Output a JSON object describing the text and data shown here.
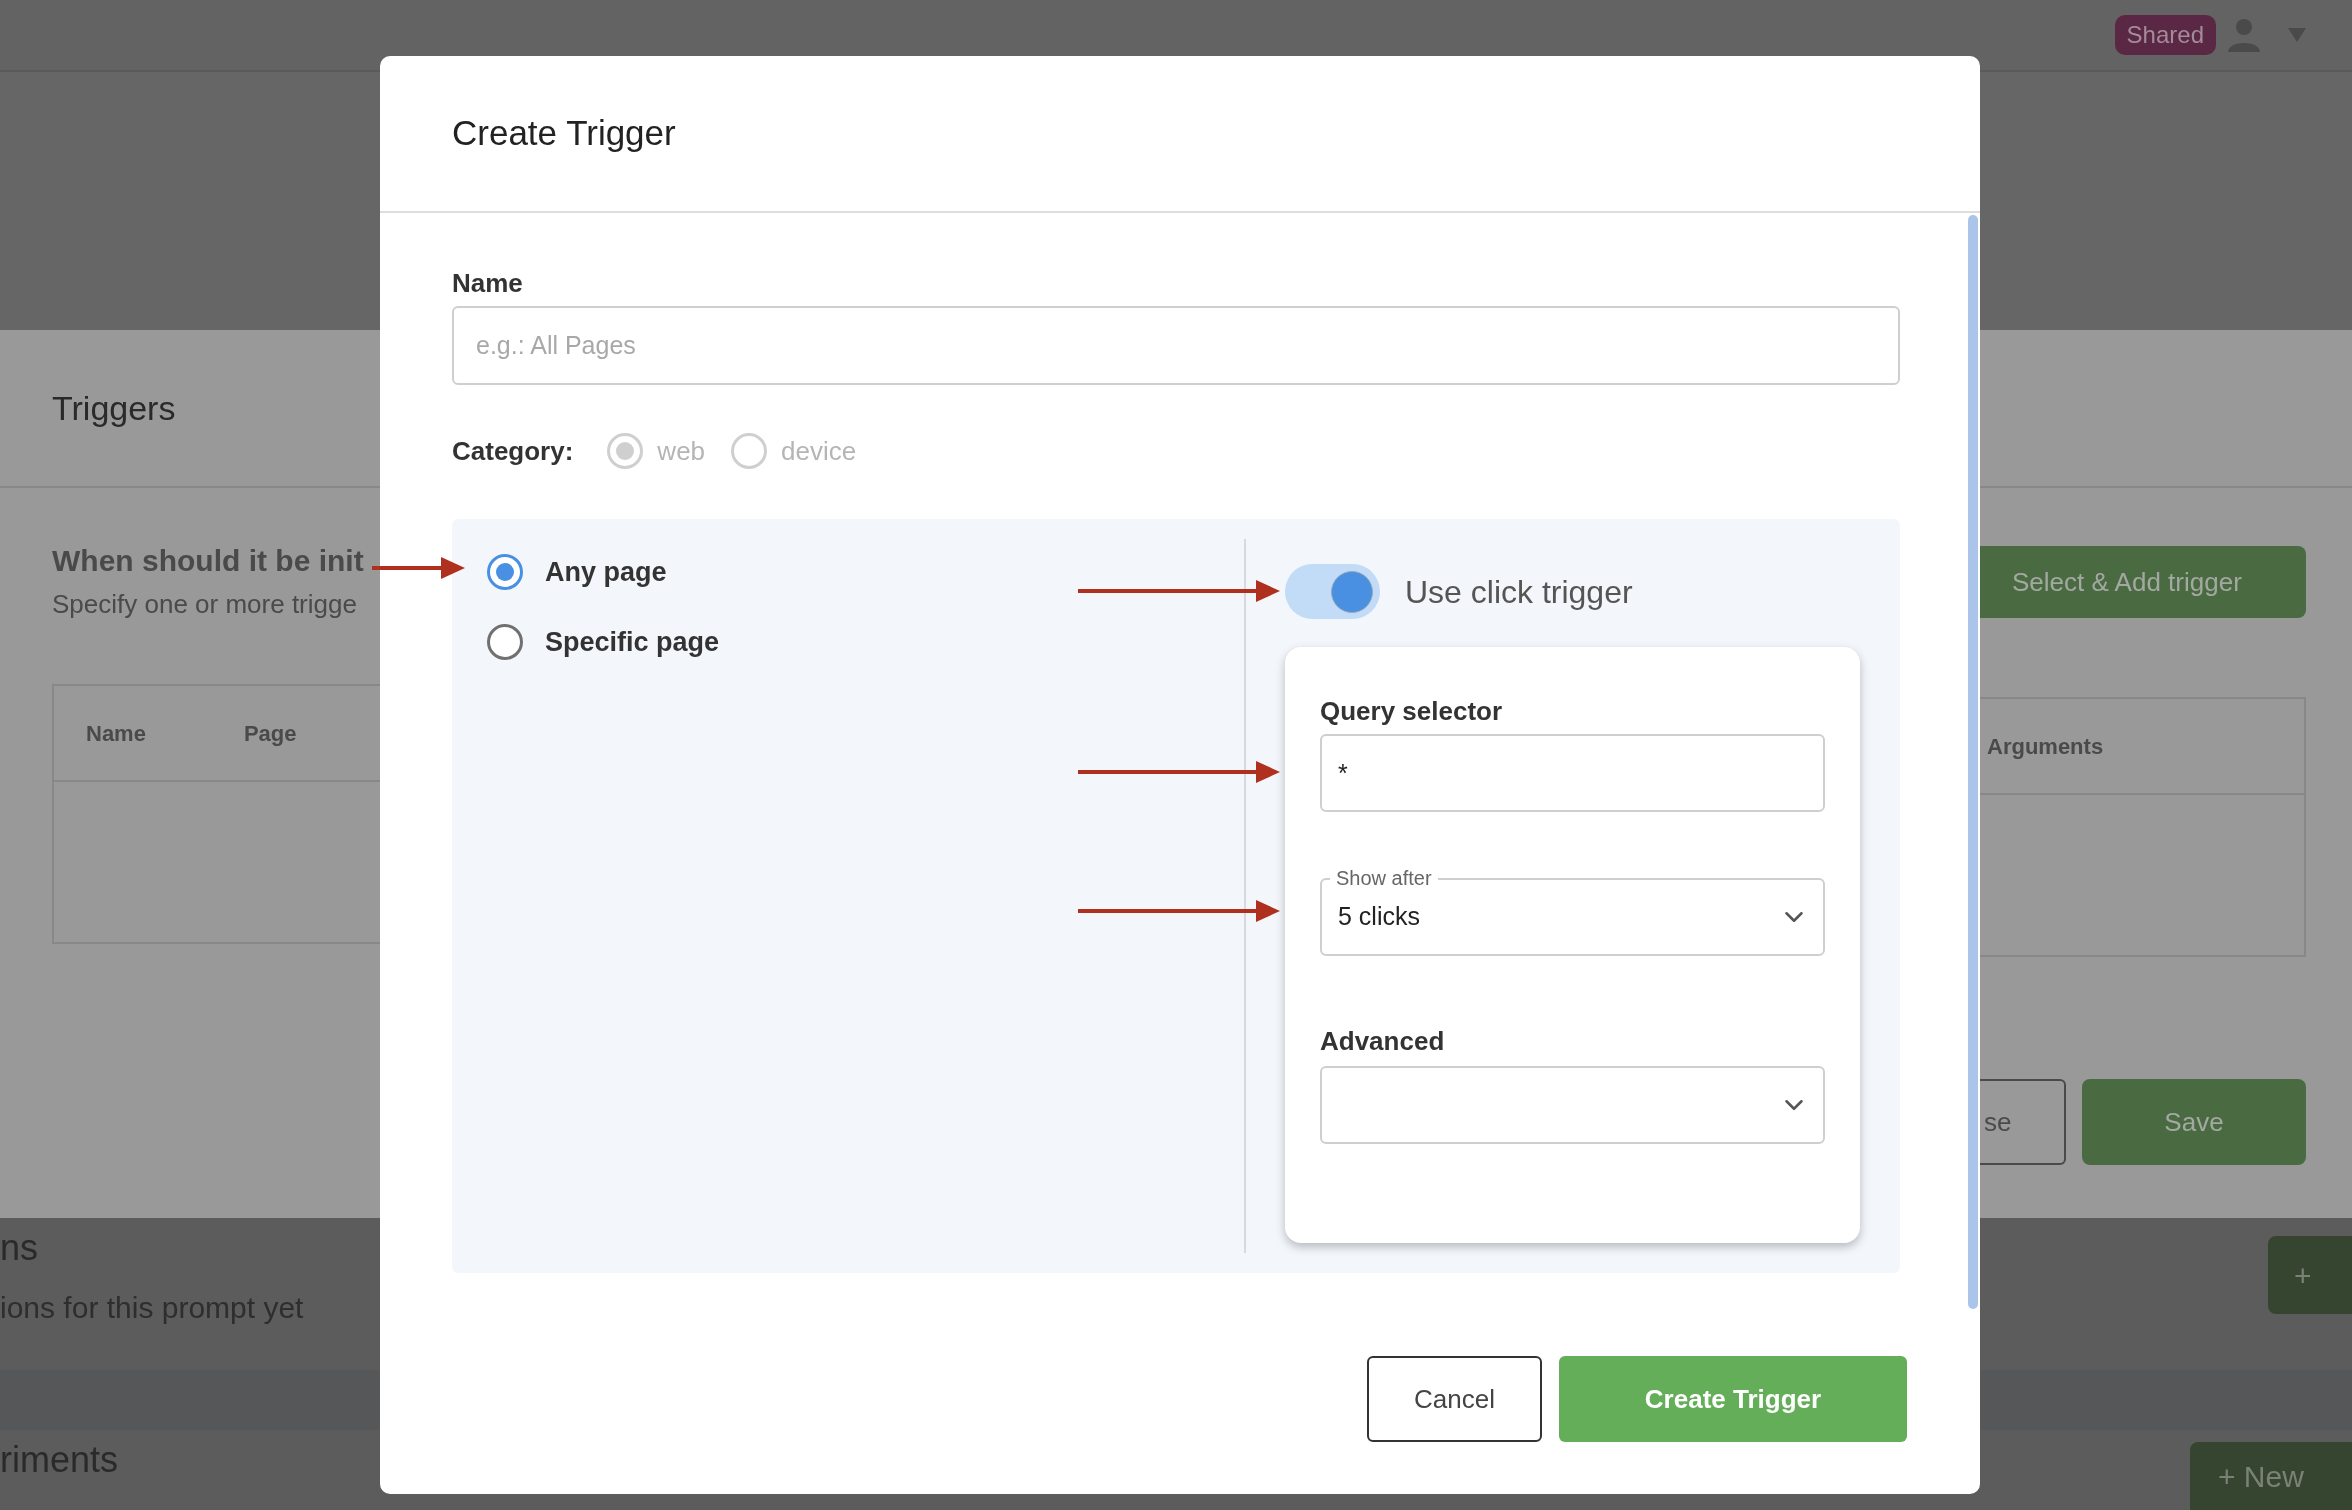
{
  "top_bar": {
    "badge": "Shared"
  },
  "background": {
    "panel": {
      "title": "Triggers",
      "question": "When should it be init",
      "hint": "Specify one or more trigge",
      "table": {
        "columns": [
          "Name",
          "Page",
          "Arguments"
        ]
      },
      "add_button": "Select & Add trigger",
      "close_button": "se",
      "save_button": "Save"
    },
    "section_1": {
      "title": "ns",
      "text": "ions for this prompt yet",
      "button": "+"
    },
    "section_2": {
      "title": "riments",
      "button": "+ New"
    }
  },
  "dialog": {
    "title": "Create Trigger",
    "name_field": {
      "label": "Name",
      "placeholder": "e.g.: All Pages"
    },
    "category": {
      "label": "Category:",
      "disabled": true,
      "options": [
        {
          "label": "web",
          "selected": true
        },
        {
          "label": "device",
          "selected": false
        }
      ]
    },
    "page_options": [
      {
        "label": "Any page",
        "selected": true
      },
      {
        "label": "Specific page",
        "selected": false
      }
    ],
    "click_trigger": {
      "label": "Use click trigger",
      "on": true
    },
    "query_selector": {
      "label": "Query selector",
      "value": "*"
    },
    "show_after": {
      "label": "Show after",
      "value": "5 clicks"
    },
    "advanced": {
      "label": "Advanced"
    },
    "buttons": [
      {
        "label": "Cancel",
        "kind": "secondary"
      },
      {
        "label": "Create Trigger",
        "kind": "primary"
      }
    ]
  }
}
